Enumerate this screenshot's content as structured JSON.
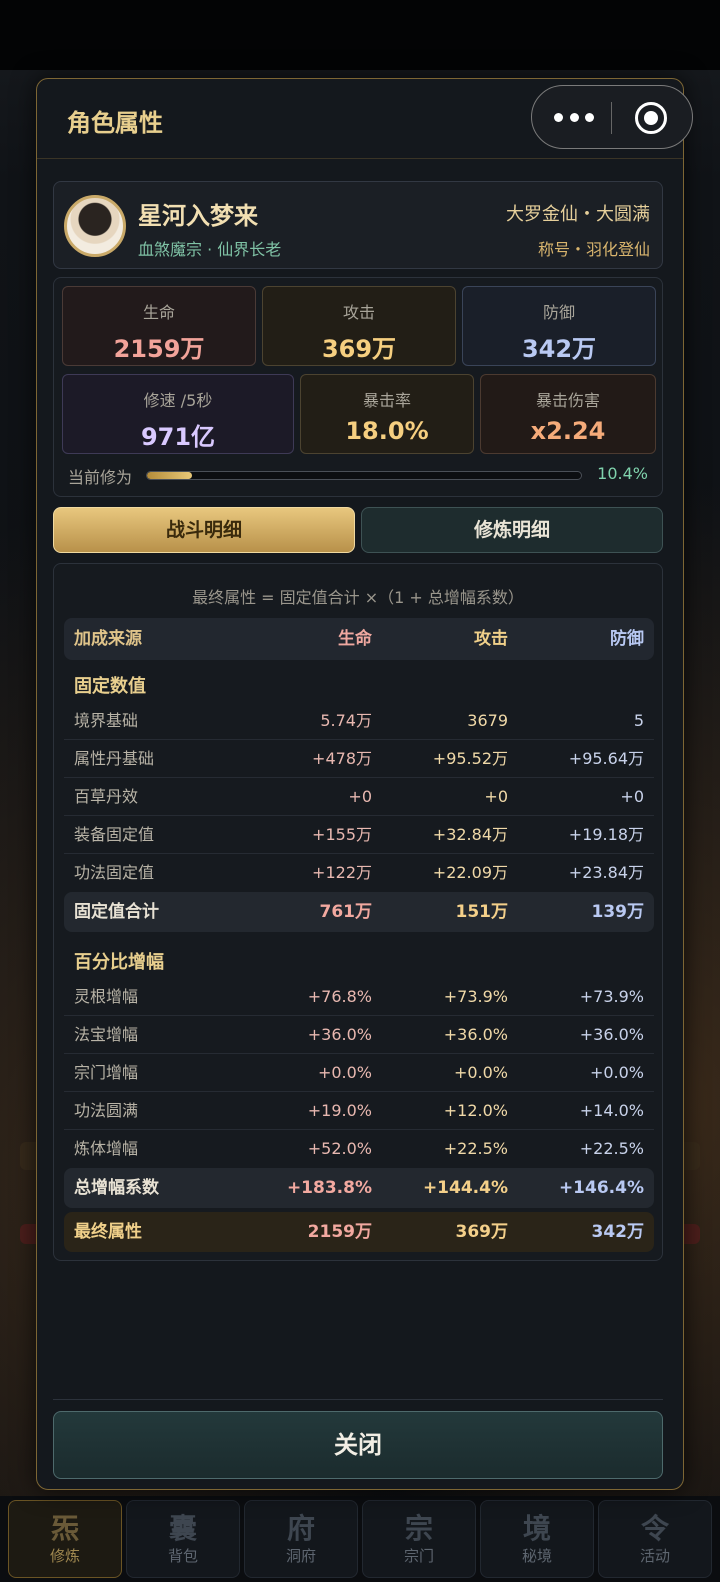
{
  "modal": {
    "title": "角色属性",
    "close_label": "关闭"
  },
  "capsule": {
    "more_icon": "more-dots-icon",
    "close_icon": "target-circle-icon"
  },
  "profile": {
    "name": "星河入梦来",
    "sect": "血煞魔宗",
    "separator": " · ",
    "role": "仙界长老",
    "realm": "大罗金仙・大圆满",
    "title": "称号・羽化登仙"
  },
  "stats": {
    "hp": {
      "label": "生命",
      "value": "2159万"
    },
    "atk": {
      "label": "攻击",
      "value": "369万"
    },
    "def": {
      "label": "防御",
      "value": "342万"
    },
    "speed": {
      "label": "修速 /5秒",
      "value": "971亿"
    },
    "crit_rate": {
      "label": "暴击率",
      "value": "18.0%"
    },
    "crit_dmg": {
      "label": "暴击伤害",
      "value": "x2.24"
    }
  },
  "progress": {
    "label": "当前修为",
    "value_text": "10.4%",
    "fraction": 0.104
  },
  "tabs": {
    "combat": "战斗明细",
    "cultivation": "修炼明细"
  },
  "detail": {
    "formula": "最终属性 = 固定值合计 ×（1 + 总增幅系数）",
    "header": {
      "source": "加成来源",
      "hp": "生命",
      "atk": "攻击",
      "def": "防御"
    },
    "fixed_title": "固定数值",
    "fixed_rows": [
      {
        "source": "境界基础",
        "hp": "5.74万",
        "atk": "3679",
        "def": "5"
      },
      {
        "source": "属性丹基础",
        "hp": "+478万",
        "atk": "+95.52万",
        "def": "+95.64万"
      },
      {
        "source": "百草丹效",
        "hp": "+0",
        "atk": "+0",
        "def": "+0"
      },
      {
        "source": "装备固定值",
        "hp": "+155万",
        "atk": "+32.84万",
        "def": "+19.18万"
      },
      {
        "source": "功法固定值",
        "hp": "+122万",
        "atk": "+22.09万",
        "def": "+23.84万"
      }
    ],
    "fixed_total": {
      "source": "固定值合计",
      "hp": "761万",
      "atk": "151万",
      "def": "139万"
    },
    "percent_title": "百分比增幅",
    "percent_rows": [
      {
        "source": "灵根增幅",
        "hp": "+76.8%",
        "atk": "+73.9%",
        "def": "+73.9%"
      },
      {
        "source": "法宝增幅",
        "hp": "+36.0%",
        "atk": "+36.0%",
        "def": "+36.0%"
      },
      {
        "source": "宗门增幅",
        "hp": "+0.0%",
        "atk": "+0.0%",
        "def": "+0.0%"
      },
      {
        "source": "功法圆满",
        "hp": "+19.0%",
        "atk": "+12.0%",
        "def": "+14.0%"
      },
      {
        "source": "炼体增幅",
        "hp": "+52.0%",
        "atk": "+22.5%",
        "def": "+22.5%"
      }
    ],
    "percent_total": {
      "source": "总增幅系数",
      "hp": "+183.8%",
      "atk": "+144.4%",
      "def": "+146.4%"
    },
    "final": {
      "source": "最终属性",
      "hp": "2159万",
      "atk": "369万",
      "def": "342万"
    }
  },
  "bottom_nav": [
    {
      "glyph": "炁",
      "label": "修炼",
      "active": true
    },
    {
      "glyph": "囊",
      "label": "背包",
      "active": false
    },
    {
      "glyph": "府",
      "label": "洞府",
      "active": false
    },
    {
      "glyph": "宗",
      "label": "宗门",
      "active": false
    },
    {
      "glyph": "境",
      "label": "秘境",
      "active": false
    },
    {
      "glyph": "令",
      "label": "活动",
      "active": false
    }
  ]
}
